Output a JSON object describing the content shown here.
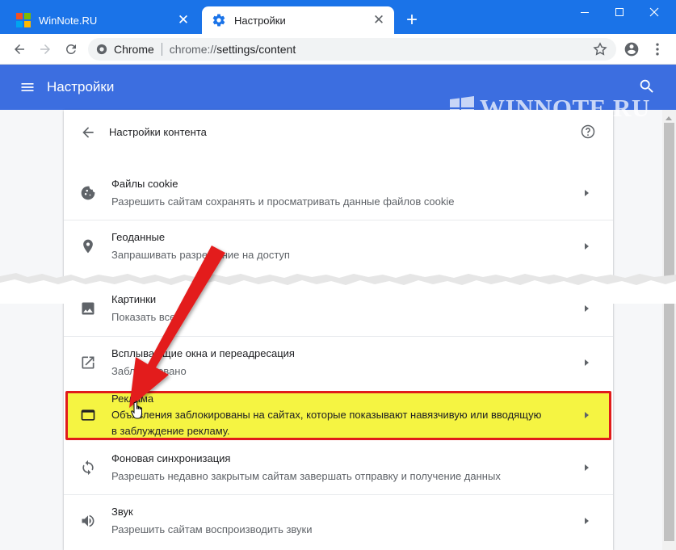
{
  "tabs": [
    {
      "title": "WinNote.RU",
      "active": false
    },
    {
      "title": "Настройки",
      "active": true
    }
  ],
  "toolbar": {
    "site_label": "Chrome",
    "url_scheme": "chrome://",
    "url_path": "settings/content"
  },
  "header": {
    "title": "Настройки"
  },
  "watermark": "WINNOTE.RU",
  "content": {
    "title": "Настройки контента",
    "rows": [
      {
        "title": "Файлы cookie",
        "subtitle": "Разрешить сайтам сохранять и просматривать данные файлов cookie",
        "icon": "cookie-icon"
      },
      {
        "title": "Геоданные",
        "subtitle": "Запрашивать разрешение на доступ",
        "icon": "location-icon"
      },
      {
        "title": "Картинки",
        "subtitle": "Показать все",
        "icon": "image-icon"
      },
      {
        "title": "Всплывающие окна и переадресация",
        "subtitle": "Заблокировано",
        "icon": "open-in-new-icon"
      },
      {
        "title": "Реклама",
        "subtitle": "Объявления заблокированы на сайтах, которые показывают навязчивую или вводящую",
        "subtitle2": "в заблуждение рекламу.",
        "icon": "ads-window-icon"
      },
      {
        "title": "Фоновая синхронизация",
        "subtitle": "Разрешать недавно закрытым сайтам завершать отправку и получение данных",
        "icon": "sync-icon"
      },
      {
        "title": "Звук",
        "subtitle": "Разрешить сайтам воспроизводить звуки",
        "icon": "volume-icon"
      }
    ]
  },
  "colors": {
    "chrome_blue": "#1a73e8",
    "settings_header": "#3c6ee0",
    "highlight_fill": "#f5f442",
    "highlight_border": "#e01b1b",
    "arrow_red": "#e31b1b"
  }
}
